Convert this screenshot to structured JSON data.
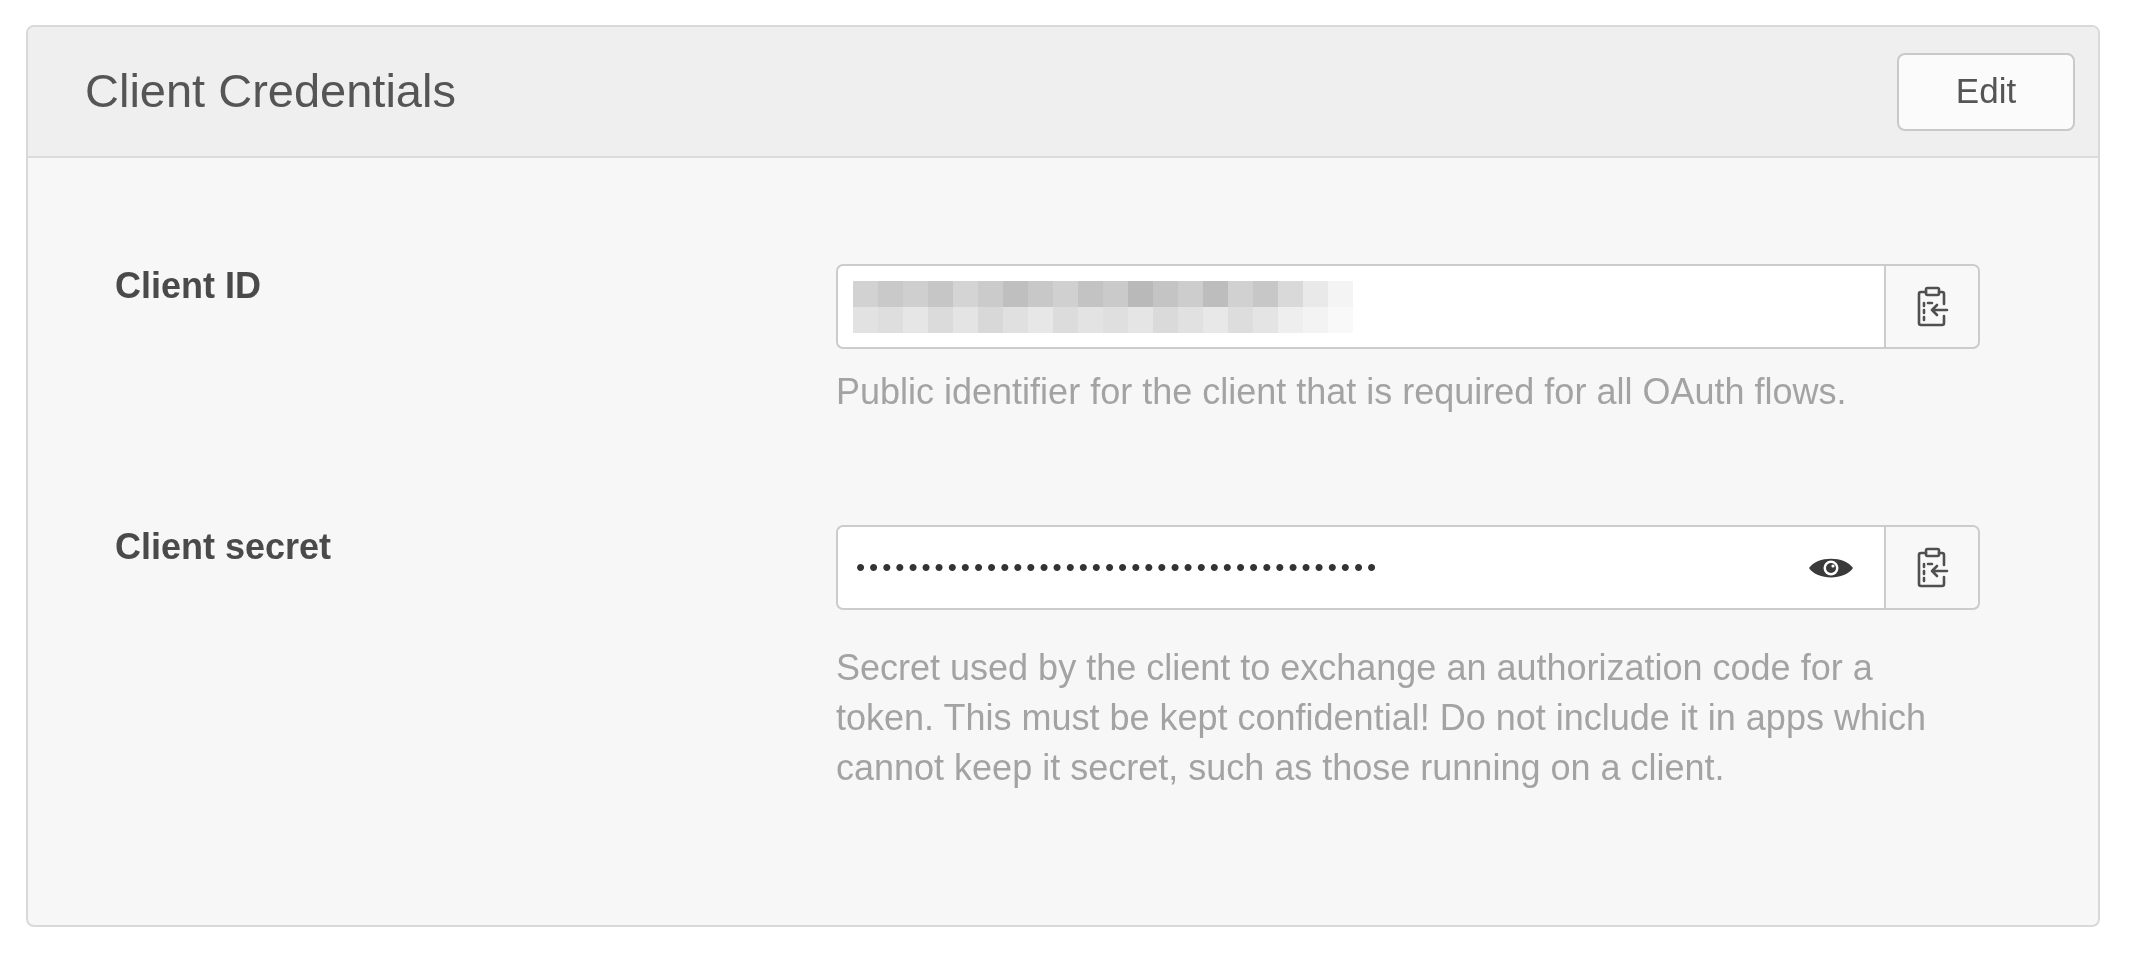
{
  "panel": {
    "title": "Client Credentials",
    "edit_button": "Edit"
  },
  "fields": [
    {
      "kind": "redacted",
      "label": "Client ID",
      "help": "Public identifier for the client that is required for all OAuth flows."
    },
    {
      "kind": "secret",
      "label": "Client secret",
      "value": "••••••••••••••••••••••••••••••••••••••••",
      "help": "Secret used by the client to exchange an authorization code for a token. This must be kept confidential! Do not include it in apps which cannot keep it secret, such as those running on a client."
    }
  ]
}
